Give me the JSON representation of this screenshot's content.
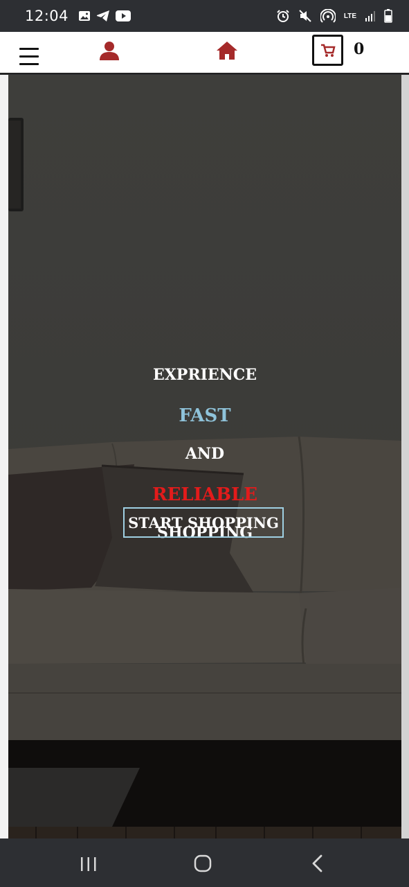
{
  "status_bar": {
    "time": "12:04",
    "network": "LTE"
  },
  "header": {
    "cart_count": "0",
    "accent_color": "#a52a2a"
  },
  "hero": {
    "line1": "EXPRIENCE",
    "line2": "FAST",
    "line3": "AND",
    "line4": "RELIABLE",
    "line5": "SHOPPING",
    "cta_label": "START SHOPPING",
    "colors": {
      "fast": "#8fc3da",
      "reliable": "#e31b1b"
    }
  }
}
